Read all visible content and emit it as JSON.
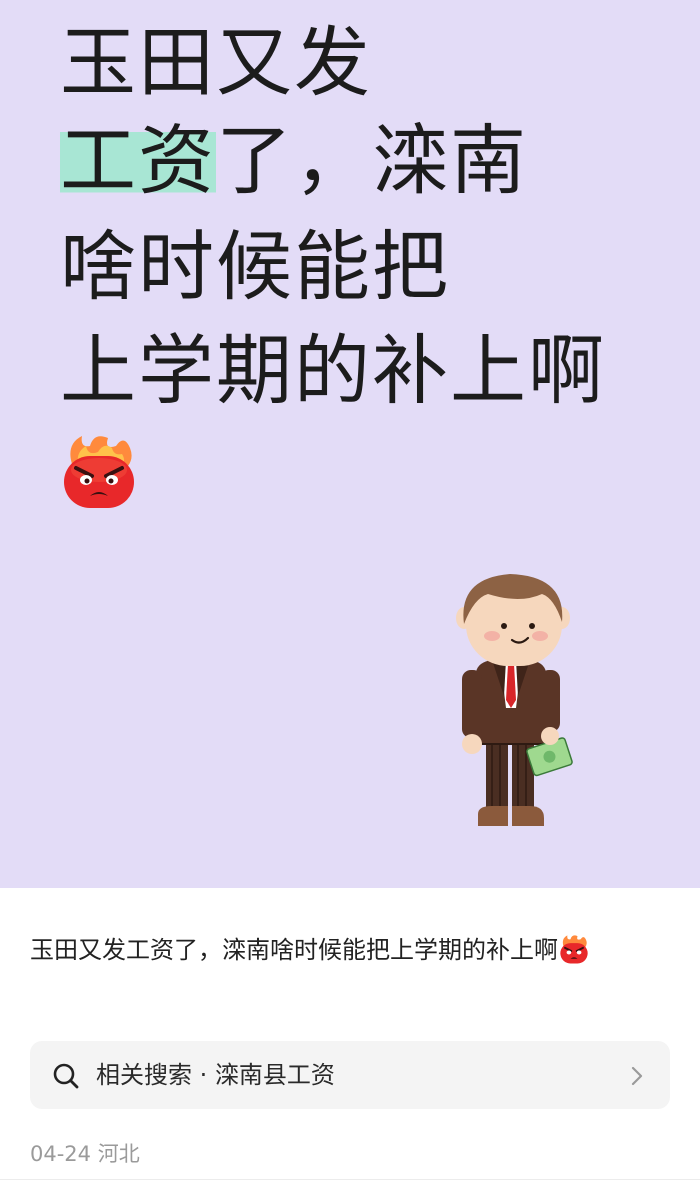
{
  "cover": {
    "lines": [
      {
        "plain": "玉田又发"
      },
      {
        "highlight": "工资",
        "rest": "了，滦南"
      },
      {
        "plain": "啥时候能把"
      },
      {
        "plain": "上学期的补上啊"
      }
    ],
    "background": "#e3dcf7",
    "highlight_color": "#a8e6d4",
    "emoji": "angry-fire-emoji",
    "illustration": "businessman-holding-money"
  },
  "caption": {
    "text": "玉田又发工资了，滦南啥时候能把上学期的补上啊",
    "emoji": "angry-fire-emoji"
  },
  "related_search": {
    "icon": "search-icon",
    "label": "相关搜索 · 滦南县工资",
    "arrow": "chevron-right-icon"
  },
  "meta": {
    "date": "04-24",
    "location": "河北"
  }
}
